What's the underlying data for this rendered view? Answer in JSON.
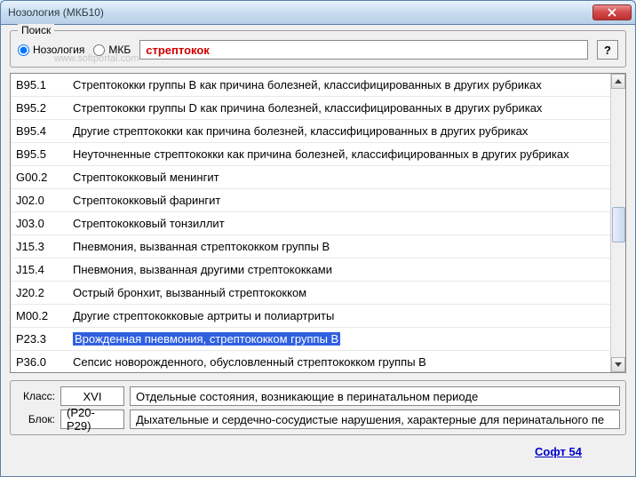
{
  "window": {
    "title": "Нозология (МКБ10)"
  },
  "watermark": "www.softportal.com",
  "search": {
    "group_label": "Поиск",
    "radio_nosology": "Нозология",
    "radio_mkb": "МКБ",
    "selected": "nosology",
    "value": "стрептокок",
    "help_label": "?"
  },
  "results": [
    {
      "code": "B95.1",
      "text": "Стрептококки группы B как причина болезней, классифицированных в других рубриках",
      "selected": false
    },
    {
      "code": "B95.2",
      "text": "Стрептококки группы D как причина болезней, классифицированных в других рубриках",
      "selected": false
    },
    {
      "code": "B95.4",
      "text": "Другие стрептококки как причина болезней, классифицированных в других рубриках",
      "selected": false
    },
    {
      "code": "B95.5",
      "text": "Неуточненные стрептококки как причина болезней, классифицированных в других рубриках",
      "selected": false
    },
    {
      "code": "G00.2",
      "text": "Стрептококковый менингит",
      "selected": false
    },
    {
      "code": "J02.0",
      "text": "Стрептококковый фарингит",
      "selected": false
    },
    {
      "code": "J03.0",
      "text": "Стрептококковый тонзиллит",
      "selected": false
    },
    {
      "code": "J15.3",
      "text": "Пневмония, вызванная стрептококком группы B",
      "selected": false
    },
    {
      "code": "J15.4",
      "text": "Пневмония, вызванная другими стрептококками",
      "selected": false
    },
    {
      "code": "J20.2",
      "text": "Острый бронхит, вызванный стрептококком",
      "selected": false
    },
    {
      "code": "M00.2",
      "text": "Другие стрептококковые артриты и полиартриты",
      "selected": false
    },
    {
      "code": "P23.3",
      "text": "Врожденная пневмония, стрептококком группы B",
      "selected": true
    },
    {
      "code": "P36.0",
      "text": "Сепсис новорожденного, обусловленный стрептококком группы B",
      "selected": false
    }
  ],
  "details": {
    "class_label": "Класс:",
    "class_code": "XVI",
    "class_text": "Отдельные состояния, возникающие в перинатальном периоде",
    "block_label": "Блок:",
    "block_code": "(P20-P29)",
    "block_text": "Дыхательные и сердечно-сосудистые нарушения, характерные для перинатального пе"
  },
  "footer": {
    "link_text": "Софт 54"
  }
}
